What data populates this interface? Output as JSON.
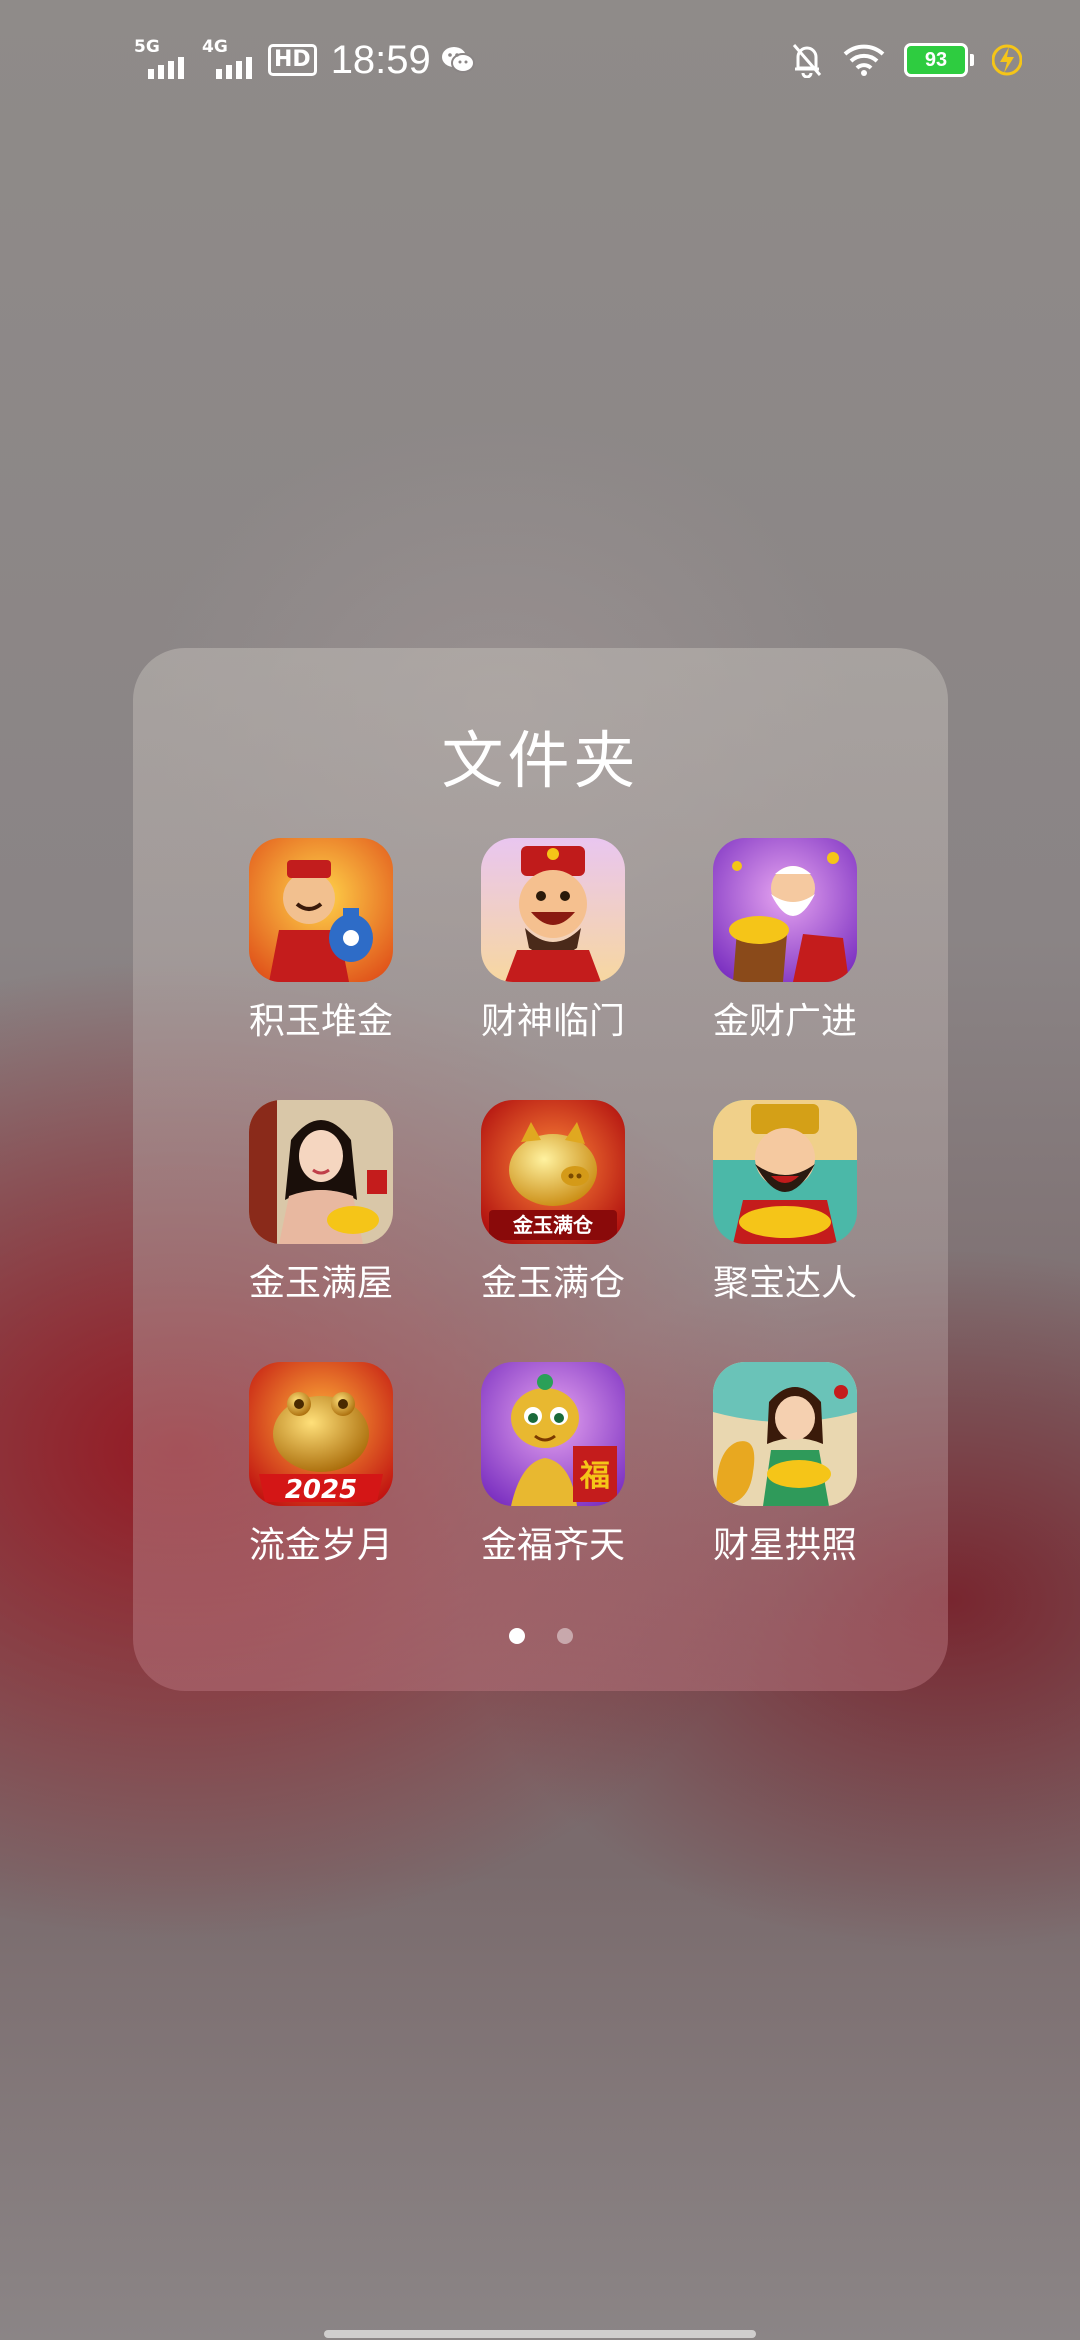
{
  "status_bar": {
    "sim1_label": "5G",
    "sim2_label": "4G",
    "hd_label": "HD",
    "time": "18:59",
    "battery_level": "93",
    "battery_color": "#2ecc40",
    "icons": [
      "wechat-icon",
      "mute-bell-icon",
      "wifi-icon",
      "charging-icon"
    ]
  },
  "folder": {
    "title": "文件夹",
    "apps": [
      {
        "label": "积玉堆金",
        "icon": "god-of-wealth-vase-icon"
      },
      {
        "label": "财神临门",
        "icon": "god-of-wealth-smile-icon"
      },
      {
        "label": "金财广进",
        "icon": "old-man-treasure-icon"
      },
      {
        "label": "金玉满屋",
        "icon": "lady-gold-icon"
      },
      {
        "label": "金玉满仓",
        "icon": "golden-pig-icon",
        "icon_text": "金玉满仓"
      },
      {
        "label": "聚宝达人",
        "icon": "bearded-god-gold-icon"
      },
      {
        "label": "流金岁月",
        "icon": "golden-toad-icon",
        "icon_text": "2025"
      },
      {
        "label": "金福齐天",
        "icon": "golden-snake-icon",
        "icon_text": "福"
      },
      {
        "label": "财星拱照",
        "icon": "girl-gold-snake-icon"
      }
    ],
    "pages": {
      "count": 2,
      "current": 1
    }
  }
}
